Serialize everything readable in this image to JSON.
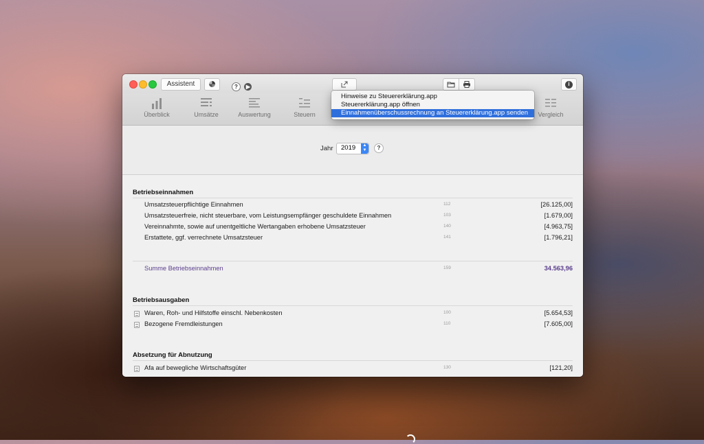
{
  "titlebar": {
    "assistant_label": "Assistent",
    "help_glyph": "?",
    "info_glyph": "i",
    "icons": [
      "share-icon",
      "folder-icon",
      "print-icon",
      "play-icon",
      "color-icon"
    ]
  },
  "share_menu": {
    "items": [
      {
        "label": "Hinweise zu Steuererklärung.app",
        "selected": false
      },
      {
        "label": "Steuererklärung.app öffnen",
        "selected": false
      },
      {
        "label": "Einnahmenüberschussrechnung an Steuererklärung.app senden",
        "selected": true
      }
    ],
    "accent": "#2f6fdc"
  },
  "toolbar": {
    "tools": [
      {
        "label": "Überblick",
        "icon": "bar-chart-icon"
      },
      {
        "label": "Umsätze",
        "icon": "transactions-icon"
      },
      {
        "label": "Auswertung",
        "icon": "report-icon"
      },
      {
        "label": "Steuern",
        "icon": "tax-icon"
      },
      {
        "label": "Vergleich",
        "icon": "compare-icon"
      }
    ]
  },
  "year": {
    "label": "Jahr",
    "value": "2019",
    "help": "?"
  },
  "sections": {
    "income": {
      "title": "Betriebseinnahmen",
      "rows": [
        {
          "label": "Umsatzsteuerpflichtige Einnahmen",
          "code": "112",
          "amount": "[26.125,00]"
        },
        {
          "label": "Umsatzsteuerfreie, nicht steuerbare, vom Leistungsempfänger geschuldete Einnahmen",
          "code": "103",
          "amount": "[1.679,00]"
        },
        {
          "label": "Vereinnahmte, sowie auf unentgeltliche Wertangaben erhobene Umsatzsteuer",
          "code": "140",
          "amount": "[4.963,75]"
        },
        {
          "label": "Erstattete, ggf. verrechnete Umsatzsteuer",
          "code": "141",
          "amount": "[1.796,21]"
        }
      ],
      "sum": {
        "label": "Summe Betriebseinnahmen",
        "code": "159",
        "amount": "34.563,96"
      }
    },
    "expenses": {
      "title": "Betriebsausgaben",
      "rows": [
        {
          "label": "Waren, Roh- und Hilfstoffe einschl. Nebenkosten",
          "code": "100",
          "amount": "[5.654,53]"
        },
        {
          "label": "Bezogene Fremdleistungen",
          "code": "110",
          "amount": "[7.605,00]"
        }
      ]
    },
    "depreciation": {
      "title": "Absetzung für Abnutzung",
      "rows": [
        {
          "label": "Afa auf bewegliche Wirtschaftsgüter",
          "code": "130",
          "amount": "[121,20]"
        }
      ]
    }
  },
  "colors": {
    "sum_text": "#5a3d8c",
    "stepper_blue": "#3b86f7"
  }
}
